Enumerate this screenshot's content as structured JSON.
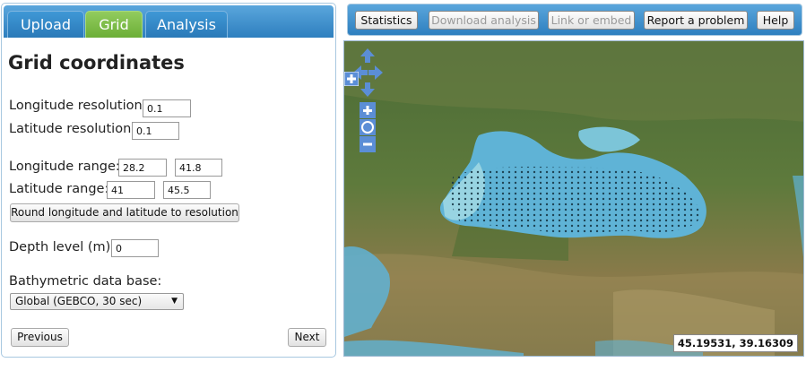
{
  "tabs": [
    {
      "label": "Upload",
      "active": false
    },
    {
      "label": "Grid",
      "active": true
    },
    {
      "label": "Analysis",
      "active": false
    }
  ],
  "grid": {
    "title": "Grid coordinates",
    "lon_res_label": "Longitude resolution:",
    "lon_res_value": "0.1",
    "lat_res_label": "Latitude resolution:",
    "lat_res_value": "0.1",
    "lon_range_label": "Longitude range:",
    "lon_range_min": "28.2",
    "lon_range_max": "41.8",
    "lat_range_label": "Latitude range:",
    "lat_range_min": "41",
    "lat_range_max": "45.5",
    "round_button": "Round longitude and latitude to resolution",
    "depth_label": "Depth level (m):",
    "depth_value": "0",
    "bathy_label": "Bathymetric data base:",
    "bathy_selected": "Global (GEBCO, 30 sec)",
    "prev_button": "Previous",
    "next_button": "Next"
  },
  "toolbar": {
    "statistics": "Statistics",
    "download": "Download analysis",
    "link": "Link or embed",
    "report": "Report a problem",
    "help": "Help"
  },
  "map": {
    "cursor_coordinates": "45.19531, 39.16309",
    "icons": [
      "pan-up-icon",
      "pan-left-icon",
      "pan-right-icon",
      "pan-down-icon",
      "zoom-in-icon",
      "zoom-reset-icon",
      "zoom-out-icon",
      "layer-switcher-icon"
    ],
    "colors": {
      "accent": "#3a8fd0",
      "active_tab": "#7cbc45",
      "sea": "#5fb3d6"
    }
  }
}
